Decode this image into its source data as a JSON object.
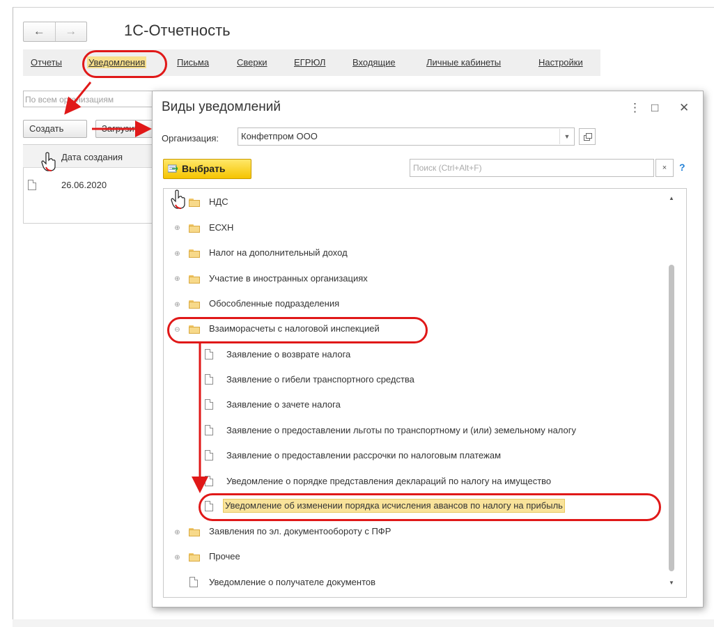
{
  "app": {
    "title": "1С-Отчетность",
    "back": "←",
    "forward": "→"
  },
  "tabs": [
    {
      "label": "Отчеты"
    },
    {
      "label": "Уведомления"
    },
    {
      "label": "Письма"
    },
    {
      "label": "Сверки"
    },
    {
      "label": "ЕГРЮЛ"
    },
    {
      "label": "Входящие"
    },
    {
      "label": "Личные кабинеты"
    },
    {
      "label": "Настройки"
    }
  ],
  "left_panel": {
    "org_filter_placeholder": "По всем организациям",
    "create_button": "Создать",
    "load_button": "Загрузить",
    "column_header": "Дата создания",
    "rows": [
      {
        "date": "26.06.2020"
      }
    ]
  },
  "dialog": {
    "title": "Виды уведомлений",
    "menu_icon": "⋮",
    "maximize_icon": "□",
    "close_icon": "✕",
    "org_label": "Организация:",
    "org_value": "Конфетпром ООО",
    "choose_button": "Выбрать",
    "search_placeholder": "Поиск (Ctrl+Alt+F)",
    "search_clear": "×",
    "help": "?",
    "tree": [
      {
        "label": "НДС",
        "type": "folder"
      },
      {
        "label": "ЕСХН",
        "type": "folder"
      },
      {
        "label": "Налог на дополнительный доход",
        "type": "folder"
      },
      {
        "label": "Участие в иностранных организациях",
        "type": "folder"
      },
      {
        "label": "Обособленные подразделения",
        "type": "folder"
      },
      {
        "label": "Взаиморасчеты с налоговой инспекцией",
        "type": "folder",
        "expanded": true
      },
      {
        "label": "Заявление о возврате налога",
        "type": "doc"
      },
      {
        "label": "Заявление о гибели транспортного средства",
        "type": "doc"
      },
      {
        "label": "Заявление о зачете налога",
        "type": "doc"
      },
      {
        "label": "Заявление о предоставлении льготы по транспортному и (или) земельному налогу",
        "type": "doc"
      },
      {
        "label": "Заявление о предоставлении рассрочки по налоговым платежам",
        "type": "doc"
      },
      {
        "label": "Уведомление о порядке представления деклараций по налогу на имущество",
        "type": "doc"
      },
      {
        "label": "Уведомление об изменении порядка исчисления авансов по налогу на прибыль",
        "type": "doc",
        "selected": true
      },
      {
        "label": "Заявления по эл. документообороту с ПФР",
        "type": "folder"
      },
      {
        "label": "Прочее",
        "type": "folder"
      },
      {
        "label": "Уведомление о получателе документов",
        "type": "doc"
      }
    ]
  },
  "colors": {
    "highlight": "#e01818",
    "accent": "#f5c400",
    "selection": "#f9e39a"
  }
}
